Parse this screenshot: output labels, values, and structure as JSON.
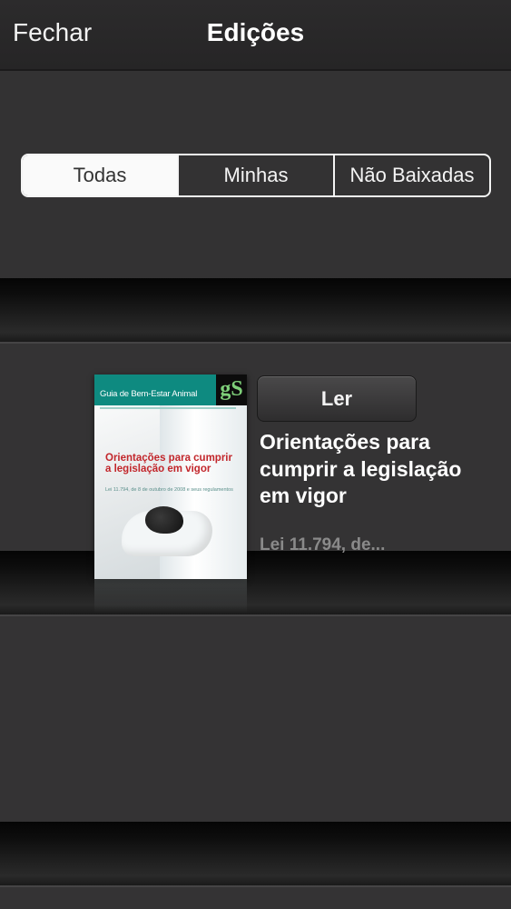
{
  "navbar": {
    "close_label": "Fechar",
    "title": "Edições"
  },
  "filter": {
    "segments": [
      "Todas",
      "Minhas",
      "Não Baixadas"
    ],
    "selected": "Todas"
  },
  "edition": {
    "cover": {
      "masthead": "Guia de Bem-Estar Animal",
      "logo": "gS",
      "headline": "Orientações para cumprir a legislação em vigor",
      "subline": "Lei 11.794, de 8 de outubro de 2008 e seus regulamentos"
    },
    "read_label": "Ler",
    "title": "Orientações para cumprir a legislação em vigor",
    "subtitle": "Lei 11.794, de..."
  }
}
